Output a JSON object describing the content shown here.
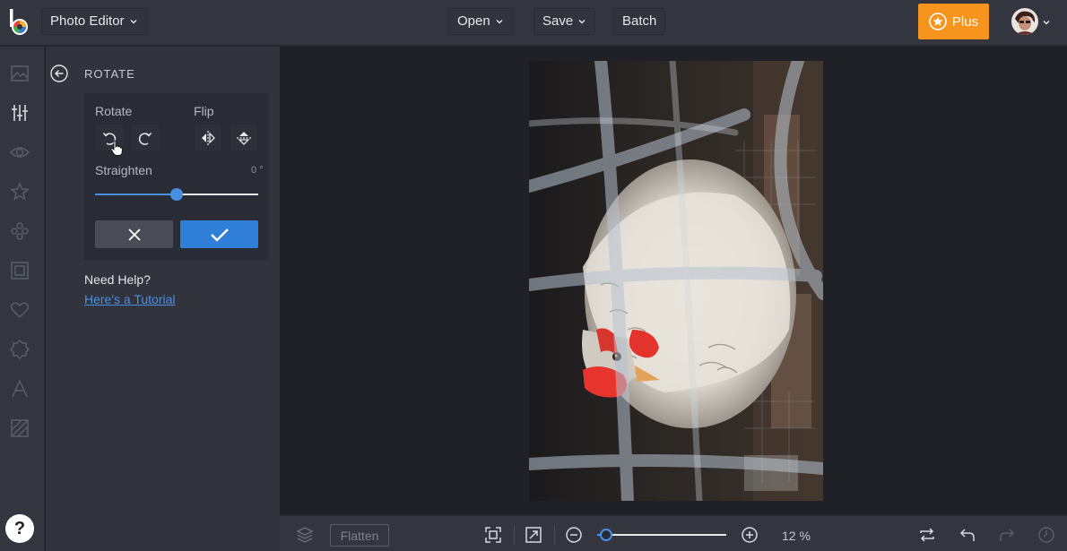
{
  "app": {
    "editor_menu_label": "Photo Editor",
    "open_label": "Open",
    "save_label": "Save",
    "batch_label": "Batch",
    "plus_label": "Plus"
  },
  "rail": {
    "icons": [
      "image-icon",
      "sliders-icon",
      "eye-icon",
      "star-icon",
      "overlay-icon",
      "frame-icon",
      "heart-icon",
      "texture-icon",
      "text-icon",
      "graphics-icon"
    ],
    "help_label": "?"
  },
  "panel": {
    "title": "ROTATE",
    "rotate_label": "Rotate",
    "flip_label": "Flip",
    "straighten_label": "Straighten",
    "straighten_value": "0 °",
    "straighten_level": 0.5,
    "need_help": "Need Help?",
    "tutorial_link": "Here's a Tutorial"
  },
  "bottom": {
    "flatten_label": "Flatten",
    "zoom_value": "12 %",
    "zoom_level": 0.02
  },
  "colors": {
    "accent": "#2f7fd8",
    "plus": "#f7941d",
    "bg": "#1f2126",
    "panel": "#31333d"
  }
}
